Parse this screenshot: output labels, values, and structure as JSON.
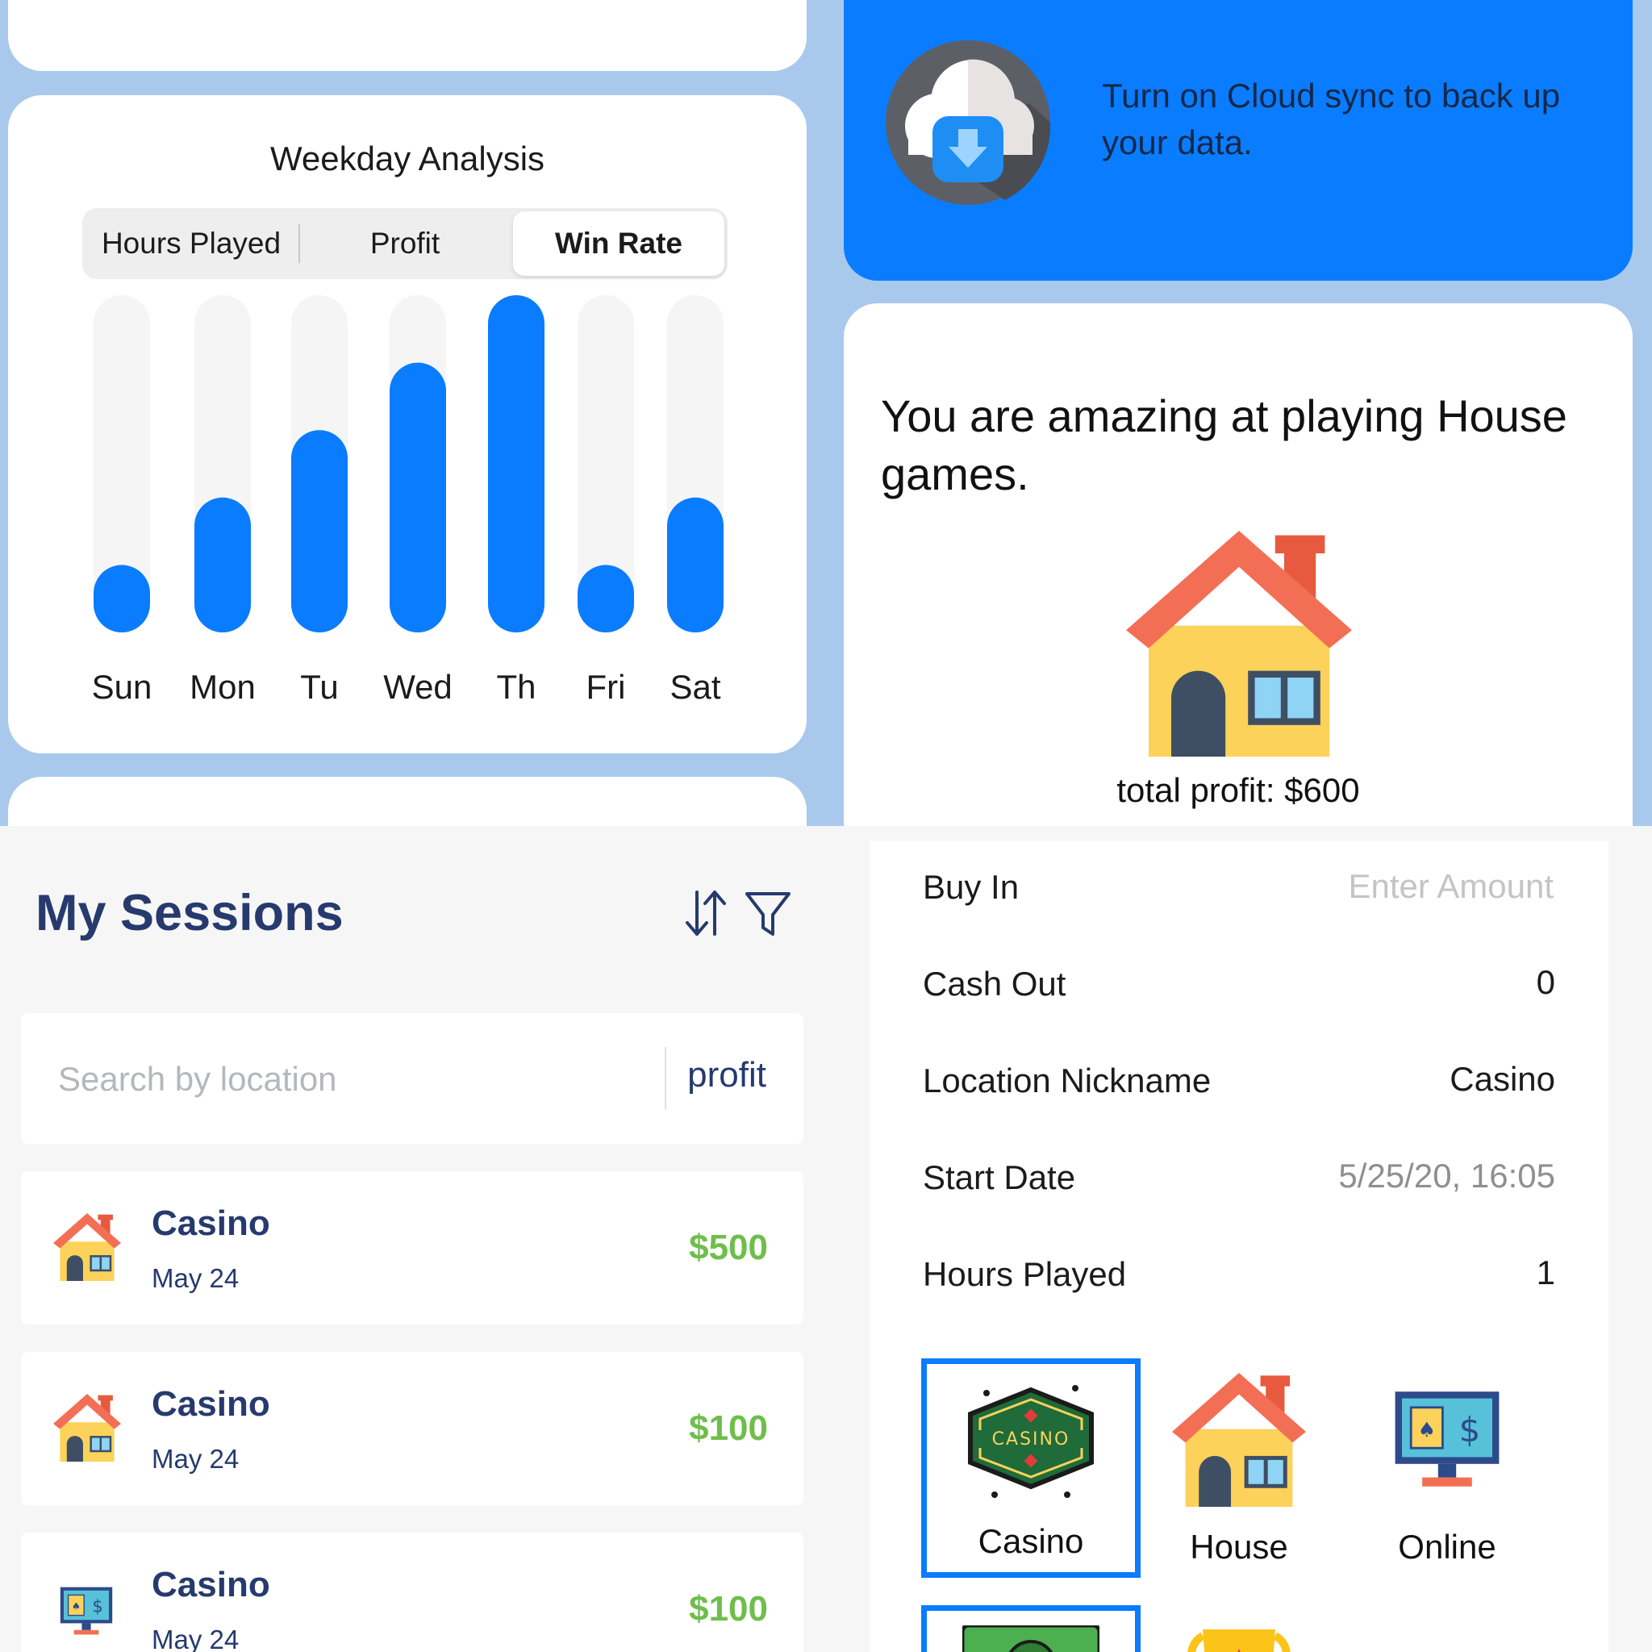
{
  "weekday_analysis": {
    "title": "Weekday Analysis",
    "tabs": [
      "Hours Played",
      "Profit",
      "Win Rate"
    ],
    "active_tab": "Win Rate",
    "chart_data": {
      "type": "bar",
      "categories": [
        "Sun",
        "Mon",
        "Tu",
        "Wed",
        "Th",
        "Fri",
        "Sat"
      ],
      "values": [
        0.2,
        0.4,
        0.6,
        0.8,
        1.0,
        0.2,
        0.4
      ],
      "ylim": [
        0,
        1
      ],
      "grid": false,
      "bar_color": "#0a7cff",
      "track_color": "#f5f5f5"
    }
  },
  "cloud_banner": {
    "text": "Turn on Cloud sync to back up your data.",
    "color": "#0a7cff"
  },
  "insight": {
    "headline": "You are amazing at playing House games.",
    "total_profit": "total profit: $600"
  },
  "sessions": {
    "title": "My Sessions",
    "search_placeholder": "Search by location",
    "sort_label": "profit",
    "items": [
      {
        "name": "Casino",
        "date": "May 24",
        "amount": "$500",
        "icon": "house-icon"
      },
      {
        "name": "Casino",
        "date": "May 24",
        "amount": "$100",
        "icon": "house-icon"
      },
      {
        "name": "Casino",
        "date": "May 24",
        "amount": "$100",
        "icon": "online-monitor-icon"
      }
    ],
    "amount_color": "#6fbe4c"
  },
  "session_form": {
    "buy_in_label": "Buy In",
    "buy_in_placeholder": "Enter Amount",
    "cash_out_label": "Cash Out",
    "cash_out_value": "0",
    "location_label": "Location Nickname",
    "location_value": "Casino",
    "start_date_label": "Start Date",
    "start_date_value": "5/25/20, 16:05",
    "hours_label": "Hours Played",
    "hours_value": "1",
    "types": [
      {
        "label": "Casino",
        "icon": "casino-sign-icon",
        "selected": true
      },
      {
        "label": "House",
        "icon": "house-icon",
        "selected": false
      },
      {
        "label": "Online",
        "icon": "online-monitor-icon",
        "selected": false
      }
    ],
    "more_types": [
      {
        "icon": "cash-icon",
        "selected": true
      },
      {
        "icon": "trophy-icon",
        "selected": false
      }
    ]
  }
}
